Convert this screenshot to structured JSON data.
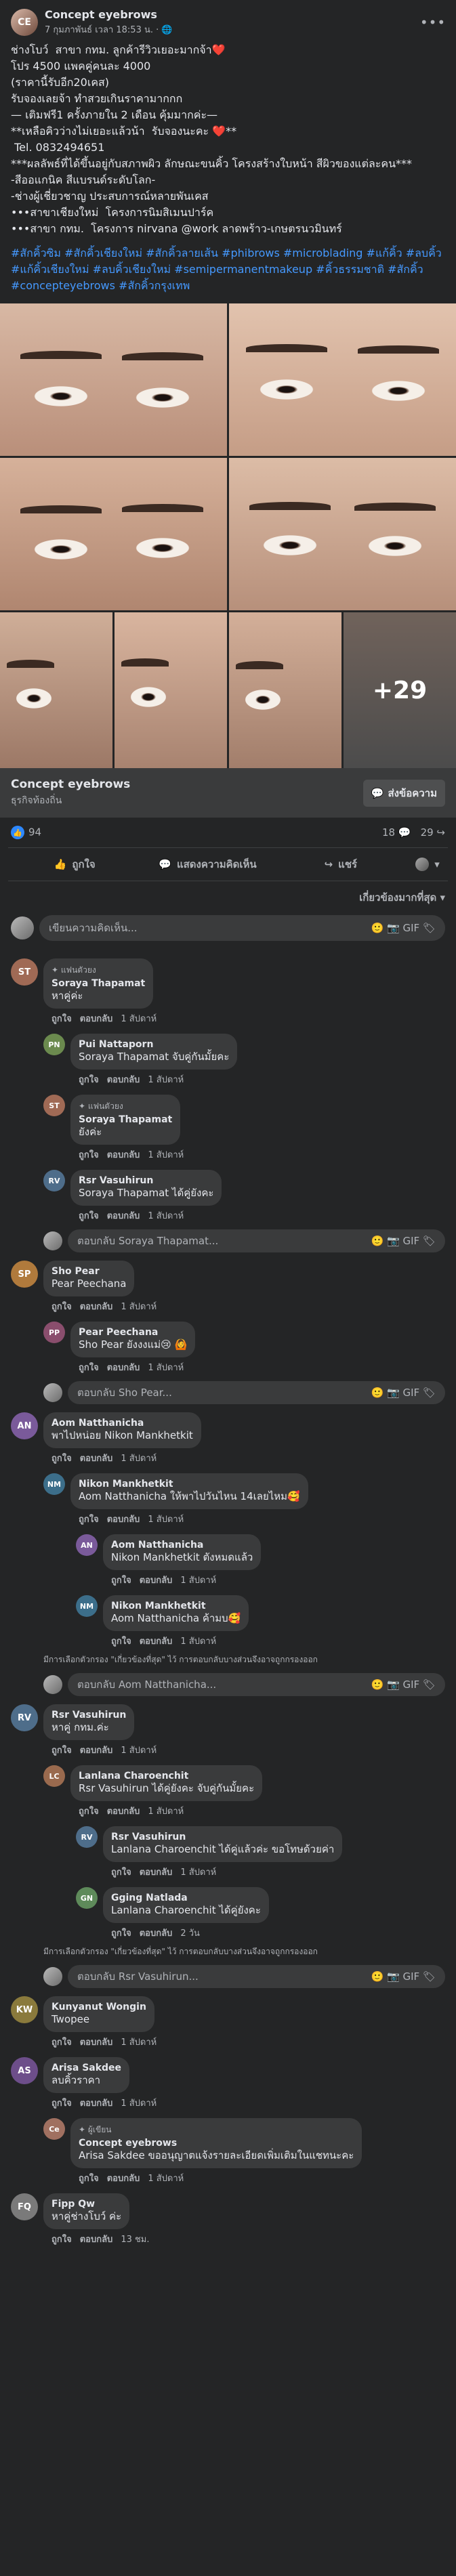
{
  "post": {
    "page_name": "Concept eyebrows",
    "time": "7 กุมภาพันธ์ เวลา 18:53 น. · 🌐",
    "avatar_initials": "CE",
    "body": "ช่างโบว์  สาขา กทม. ลูกค้ารีวิวเยอะมากจ้า❤️\nโปร 4500 แพคคู่คนละ 4000\n(ราคานี้รับอีก20เคส)\nรับจองเลยจ้า ทำสวยเกินราคามากกก\n— เติมฟรี1 ครั้งภายใน 2 เดือน คุ้มมากค่ะ—\n**เหลือคิวว่างไม่เยอะแล้วน้า  รับจองนะคะ ❤️**\n Tel. 0832494651\n***ผลลัพธ์ที่ได้ขึ้นอยู่กับสภาพผิว ลักษณะขนคิ้ว โครงสร้างใบหน้า สีผิวของแต่ละคน***\n-สีออแกนิค สีแบรนด์ระดับโลก-\n-ช่างผู้เชี่ยวชาญ ประสบการณ์หลายพันเคส\n•••สาขาเชียงใหม่  โครงการนิมสิเมนปาร์ค\n•••สาขา กทม.  โครงการ nirvana @work ลาดพร้าว-เกษตรนวมินทร์",
    "hashtags": "#สักคิ้วซิม #สักคิ้วเชียงใหม่ #สักคิ้วลายเส้น #phibrows #microblading #แก้คิ้ว #ลบคิ้ว #แก้คิ้วเชียงใหม่ #ลบคิ้วเชียงใหม่ #semipermanentmakeup #คิ้วธรรมชาติ #สักคิ้ว #concepteyebrows #สักคิ้วกรุงเทพ",
    "more_photos": "+29"
  },
  "page_card": {
    "name": "Concept eyebrows",
    "category": "ธุรกิจท้องถิ่น",
    "button": "ส่งข้อความ"
  },
  "stats": {
    "reactions": "94",
    "comments": "18 💬",
    "shares": "29 ↪"
  },
  "actions": {
    "like": "ถูกใจ",
    "comment": "แสดงความคิดเห็น",
    "share": "แชร์"
  },
  "sort": "เกี่ยวข้องมากที่สุด ▾",
  "composer": {
    "placeholder": "เขียนความคิดเห็น...",
    "icons": "🙂 📷 GIF 🏷"
  },
  "labels": {
    "like": "ถูกใจ",
    "reply": "ตอบกลับ",
    "note": "มีการเลือกตัวกรอง \"เกี่ยวข้องที่สุด\" ไว้ การตอบกลับบางส่วนจึงอาจถูกกรองออก",
    "fan_badge": "แฟนตัวยง",
    "author_badge": "ผู้เขียน"
  },
  "comments": [
    {
      "author": "Soraya Thapamat",
      "text": "หาคู่ค่ะ",
      "time": "1 สัปดาห์",
      "badge": "แฟนตัวยง",
      "color": "#a06a55"
    },
    {
      "author": "Pui Nattaporn",
      "text": "Soraya Thapamat จับคู่กันมั้ยคะ",
      "time": "1 สัปดาห์",
      "color": "#6b8a4e"
    },
    {
      "author": "Soraya Thapamat",
      "text": "ยังค่ะ",
      "time": "1 สัปดาห์",
      "badge": "แฟนตัวยง",
      "color": "#a06a55"
    },
    {
      "author": "Rsr Vasuhirun",
      "text": "Soraya Thapamat ได้คู่ยังคะ",
      "time": "1 สัปดาห์",
      "color": "#4e6d8a"
    },
    {
      "reply_placeholder": "ตอบกลับ Soraya Thapamat..."
    },
    {
      "author": "Sho Pear",
      "text": "Pear Peechana",
      "time": "1 สัปดาห์",
      "color": "#b07a3c"
    },
    {
      "author": "Pear Peechana",
      "text": "Sho Pear ยังงงแม่😢 🙆",
      "time": "1 สัปดาห์",
      "color": "#8a4e6d"
    },
    {
      "reply_placeholder": "ตอบกลับ Sho Pear..."
    },
    {
      "author": "Aom Natthanicha",
      "text": "พาไปหน่อย Nikon Mankhetkit",
      "time": "1 สัปดาห์",
      "color": "#7a5a9a"
    },
    {
      "author": "Nikon Mankhetkit",
      "text": "Aom Natthanicha ให้พาไปวันไหน 14เลยไหม🥰",
      "time": "1 สัปดาห์",
      "color": "#3c6e8a"
    },
    {
      "author": "Aom Natthanicha",
      "text": "Nikon Mankhetkit ตังหมดแล้ว",
      "time": "1 สัปดาห์",
      "color": "#7a5a9a"
    },
    {
      "author": "Nikon Mankhetkit",
      "text": "Aom Natthanicha ค้ามบ🥰",
      "time": "1 สัปดาห์",
      "color": "#3c6e8a"
    },
    {
      "reply_placeholder": "ตอบกลับ Aom Natthanicha..."
    },
    {
      "author": "Rsr Vasuhirun",
      "text": "หาคู่ กทม.ค่ะ",
      "time": "1 สัปดาห์",
      "color": "#4e6d8a"
    },
    {
      "author": "Lanlana Charoenchit",
      "text": "Rsr Vasuhirun ได้คู่ยังคะ จับคู่กันมั้ยคะ",
      "time": "1 สัปดาห์",
      "color": "#9a6a4e"
    },
    {
      "author": "Rsr Vasuhirun",
      "text": "Lanlana Charoenchit ได้คู่แล้วค่ะ ขอโทษด้วยค่า",
      "time": "1 สัปดาห์",
      "color": "#4e6d8a"
    },
    {
      "author": "Gging Natlada",
      "text": "Lanlana Charoenchit ได้คู่ยังคะ",
      "time": "2 วัน",
      "color": "#5e8a5a"
    },
    {
      "reply_placeholder": "ตอบกลับ Rsr Vasuhirun..."
    },
    {
      "author": "Kunyanut Wongin",
      "text": "Twopee",
      "time": "1 สัปดาห์",
      "color": "#8a7a3c"
    },
    {
      "author": "Arisa Sakdee",
      "text": "ลบคิ้วราคา",
      "time": "1 สัปดาห์",
      "color": "#6d4e8a"
    },
    {
      "author": "Concept eyebrows",
      "text": "Arisa Sakdee ขออนุญาตแจ้งรายละเอียดเพิ่มเติมในแชทนะคะ",
      "time": "1 สัปดาห์",
      "badge": "ผู้เขียน",
      "color": "#a07060"
    },
    {
      "author": "Fipp Qw",
      "text": "หาคู่ช่างโบว์ ค่ะ",
      "time": "13 ชม.",
      "color": "#7a7a7a"
    }
  ]
}
